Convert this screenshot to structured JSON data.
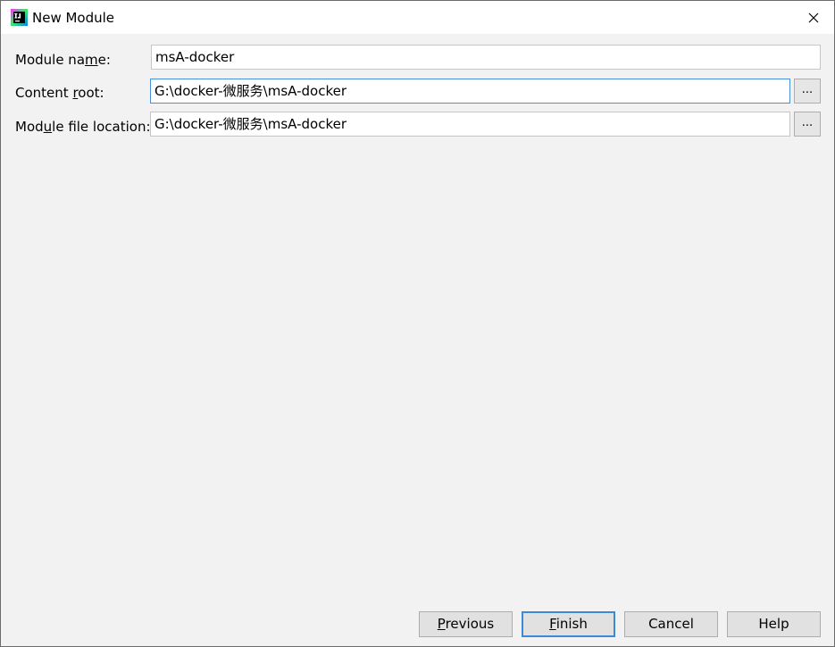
{
  "window": {
    "title": "New Module"
  },
  "form": {
    "module_name": {
      "label_before": "Module na",
      "label_mnemonic": "m",
      "label_after": "e:",
      "value": "msA-docker"
    },
    "content_root": {
      "label_before": "Content ",
      "label_mnemonic": "r",
      "label_after": "oot:",
      "value": "G:\\docker-微服务\\msA-docker",
      "browse_label": "..."
    },
    "module_file_location": {
      "label_before": "Mod",
      "label_mnemonic": "u",
      "label_after": "le file location:",
      "value": "G:\\docker-微服务\\msA-docker",
      "browse_label": "..."
    }
  },
  "buttons": {
    "previous": {
      "mnemonic": "P",
      "rest": "revious"
    },
    "finish": {
      "mnemonic": "F",
      "rest": "inish"
    },
    "cancel": {
      "label": "Cancel"
    },
    "help": {
      "label": "Help"
    }
  },
  "colors": {
    "focus_border": "#4a90d9",
    "default_button_border": "#3c8ad6",
    "dialog_background": "#f2f2f2"
  },
  "icons": {
    "app": "intellij-idea-icon",
    "close": "close-icon"
  }
}
